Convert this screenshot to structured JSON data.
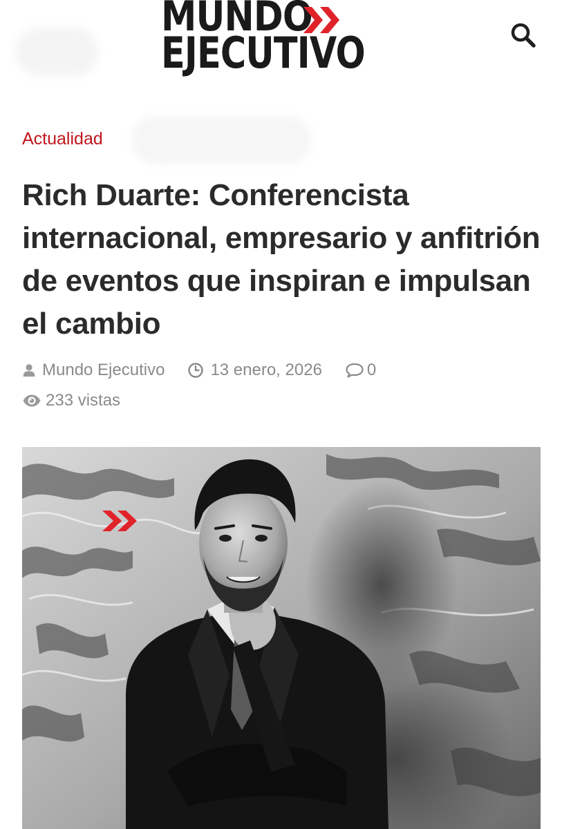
{
  "header": {
    "logo": {
      "line1": "MUNDO",
      "line2": "EJECUTIVO",
      "accent_color": "#e0232a"
    },
    "search_icon": "search-icon"
  },
  "article": {
    "category": "Actualidad",
    "category_color": "#c0151b",
    "title": "Rich Duarte: Conferencista internacional, empresario y anfitrión de eventos que inspiran e impulsan el cambio",
    "meta": {
      "author": "Mundo Ejecutivo",
      "author_icon": "user-icon",
      "date": "13 enero, 2026",
      "date_icon": "clock-icon",
      "comments": "0",
      "comments_icon": "comment-icon",
      "views": "233 vistas",
      "views_icon": "eye-icon"
    },
    "featured_image": {
      "style": "black-and-white portrait",
      "accent_color": "#e0232a"
    }
  }
}
